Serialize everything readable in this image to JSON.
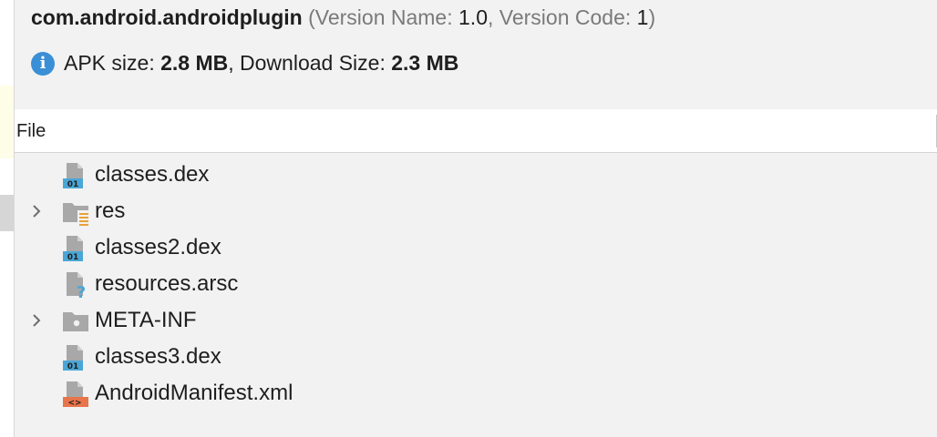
{
  "header": {
    "package_name": "com.android.androidplugin",
    "meta_open": " (Version Name: ",
    "version_name": "1.0",
    "meta_mid": ", Version Code: ",
    "version_code": "1",
    "meta_close": ")"
  },
  "size_info": {
    "icon": "info-icon",
    "icon_glyph": "i",
    "apk_label": "APK size: ",
    "apk_value": "2.8 MB",
    "download_label": ", Download Size: ",
    "download_value": "2.3 MB"
  },
  "columns": {
    "file": "File"
  },
  "colors": {
    "info_blue": "#3a8fd6",
    "dex_blue": "#4aa6d6",
    "xml_orange": "#e8744a",
    "folder_gray": "#a8a8a8",
    "res_orange": "#e8a23a"
  },
  "tree": [
    {
      "name": "classes.dex",
      "icon": "dex-file-icon",
      "expandable": false
    },
    {
      "name": "res",
      "icon": "resource-folder-icon",
      "expandable": true
    },
    {
      "name": "classes2.dex",
      "icon": "dex-file-icon",
      "expandable": false
    },
    {
      "name": "resources.arsc",
      "icon": "unknown-file-icon",
      "expandable": false
    },
    {
      "name": "META-INF",
      "icon": "folder-icon",
      "expandable": true
    },
    {
      "name": "classes3.dex",
      "icon": "dex-file-icon",
      "expandable": false
    },
    {
      "name": "AndroidManifest.xml",
      "icon": "xml-file-icon",
      "expandable": false
    }
  ]
}
